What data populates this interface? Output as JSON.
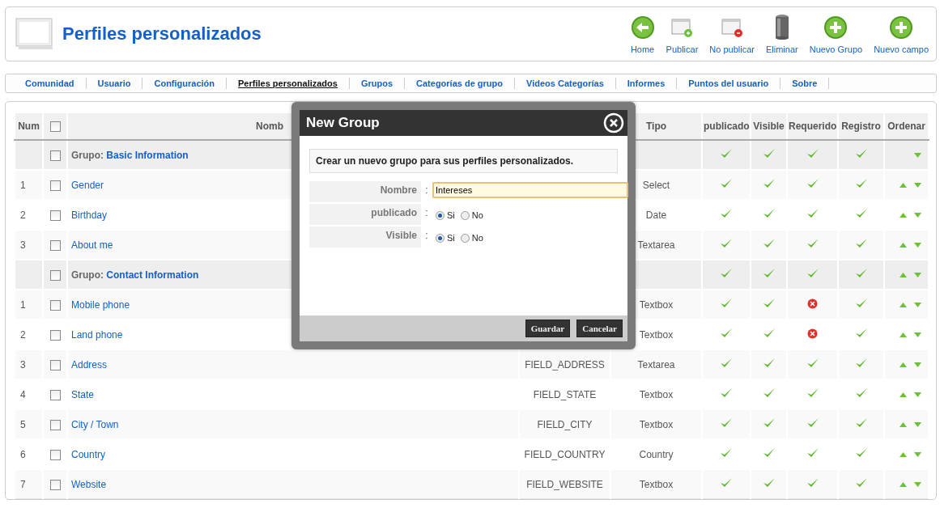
{
  "header": {
    "title": "Perfiles personalizados"
  },
  "toolbar": [
    {
      "kind": "home",
      "label": "Home"
    },
    {
      "kind": "publish",
      "label": "Publicar"
    },
    {
      "kind": "unpublish",
      "label": "No publicar"
    },
    {
      "kind": "delete",
      "label": "Eliminar"
    },
    {
      "kind": "add",
      "label": "Nuevo Grupo"
    },
    {
      "kind": "add",
      "label": "Nuevo campo"
    }
  ],
  "nav": [
    {
      "label": "Comunidad",
      "selected": false
    },
    {
      "label": "Usuario",
      "selected": false
    },
    {
      "label": "Configuración",
      "selected": false
    },
    {
      "label": "Perfiles personalizados",
      "selected": true
    },
    {
      "label": "Grupos",
      "selected": false
    },
    {
      "label": "Categorías de grupo",
      "selected": false
    },
    {
      "label": "Videos Categorías",
      "selected": false
    },
    {
      "label": "Informes",
      "selected": false
    },
    {
      "label": "Puntos del usuario",
      "selected": false
    },
    {
      "label": "Sobre",
      "selected": false
    }
  ],
  "table": {
    "columns": {
      "num": "Num",
      "select_all_checked": false,
      "nombre": "Nomb",
      "tipo": "Tipo",
      "publicado": "publicado",
      "visible": "Visible",
      "requerido": "Requerido",
      "registro": "Registro",
      "ordenar": "Ordenar"
    },
    "rows": [
      {
        "kind": "group",
        "checked": false,
        "label": "Grupo:",
        "name": "Basic Information",
        "publicado": true,
        "visible": true,
        "requerido": true,
        "registro": true,
        "up": false,
        "down": true
      },
      {
        "kind": "field",
        "num": "1",
        "checked": false,
        "name": "Gender",
        "tipo": "Select",
        "publicado": true,
        "visible": true,
        "requerido": true,
        "registro": true,
        "up": true,
        "down": true
      },
      {
        "kind": "field",
        "num": "2",
        "checked": false,
        "name": "Birthday",
        "tipo": "Date",
        "publicado": true,
        "visible": true,
        "requerido": true,
        "registro": true,
        "up": true,
        "down": true
      },
      {
        "kind": "field",
        "num": "3",
        "checked": false,
        "name": "About me",
        "tipo": "Textarea",
        "publicado": true,
        "visible": true,
        "requerido": true,
        "registro": true,
        "up": true,
        "down": true
      },
      {
        "kind": "group",
        "checked": false,
        "label": "Grupo:",
        "name": "Contact Information",
        "publicado": true,
        "visible": true,
        "requerido": true,
        "registro": true,
        "up": true,
        "down": true
      },
      {
        "kind": "field",
        "num": "1",
        "checked": false,
        "name": "Mobile phone",
        "tipo": "Textbox",
        "publicado": true,
        "visible": true,
        "requerido": false,
        "registro": true,
        "up": true,
        "down": true
      },
      {
        "kind": "field",
        "num": "2",
        "checked": false,
        "name": "Land phone",
        "tipo": "Textbox",
        "publicado": true,
        "visible": true,
        "requerido": false,
        "registro": true,
        "up": true,
        "down": true
      },
      {
        "kind": "field",
        "num": "3",
        "checked": false,
        "name": "Address",
        "code": "FIELD_ADDRESS",
        "tipo": "Textarea",
        "publicado": true,
        "visible": true,
        "requerido": true,
        "registro": true,
        "up": true,
        "down": true
      },
      {
        "kind": "field",
        "num": "4",
        "checked": false,
        "name": "State",
        "code": "FIELD_STATE",
        "tipo": "Textbox",
        "publicado": true,
        "visible": true,
        "requerido": true,
        "registro": true,
        "up": true,
        "down": true
      },
      {
        "kind": "field",
        "num": "5",
        "checked": false,
        "name": "City / Town",
        "code": "FIELD_CITY",
        "tipo": "Textbox",
        "publicado": true,
        "visible": true,
        "requerido": true,
        "registro": true,
        "up": true,
        "down": true
      },
      {
        "kind": "field",
        "num": "6",
        "checked": false,
        "name": "Country",
        "code": "FIELD_COUNTRY",
        "tipo": "Country",
        "publicado": true,
        "visible": true,
        "requerido": true,
        "registro": true,
        "up": true,
        "down": true
      },
      {
        "kind": "field",
        "num": "7",
        "checked": false,
        "name": "Website",
        "code": "FIELD_WEBSITE",
        "tipo": "Textbox",
        "publicado": true,
        "visible": true,
        "requerido": true,
        "registro": true,
        "up": true,
        "down": true
      }
    ]
  },
  "dialog": {
    "title": "New Group",
    "info": "Crear un nuevo grupo para sus perfiles personalizados.",
    "fields": [
      {
        "kind": "text",
        "label": "Nombre",
        "colon": ":",
        "value": "Intereses"
      },
      {
        "kind": "radio",
        "label": "publicado",
        "colon": ":",
        "options": [
          {
            "label": "Si",
            "selected": true
          },
          {
            "label": "No",
            "selected": false
          }
        ]
      },
      {
        "kind": "radio",
        "label": "Visible",
        "colon": ":",
        "options": [
          {
            "label": "Si",
            "selected": true
          },
          {
            "label": "No",
            "selected": false
          }
        ]
      }
    ],
    "buttons": [
      "Guardar",
      "Cancelar"
    ]
  }
}
